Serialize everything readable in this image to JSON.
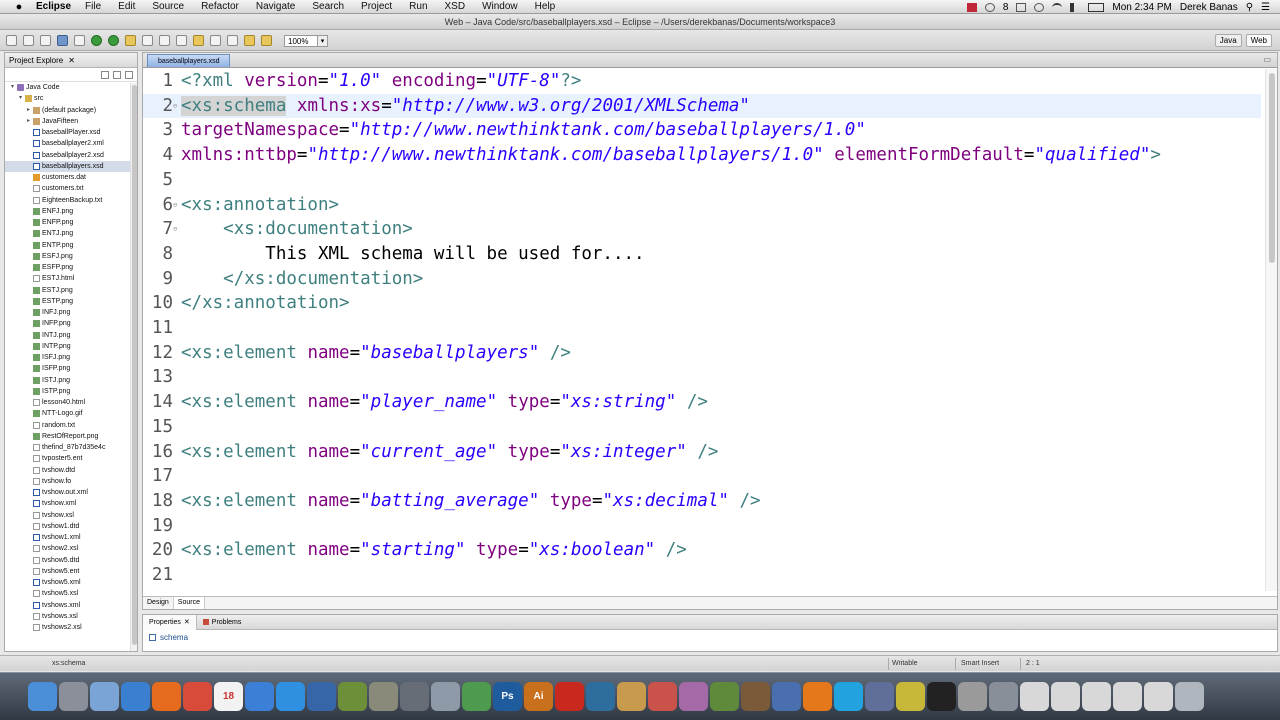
{
  "menubar": {
    "app_name": "Eclipse",
    "items": [
      "File",
      "Edit",
      "Source",
      "Refactor",
      "Navigate",
      "Search",
      "Project",
      "Run",
      "XSD",
      "Window",
      "Help"
    ],
    "status_number": "8",
    "clock": "Mon 2:34 PM",
    "user": "Derek Banas"
  },
  "window": {
    "title": "Web – Java Code/src/baseballplayers.xsd – Eclipse – /Users/derekbanas/Documents/workspace3"
  },
  "toolbar": {
    "zoom": "100%",
    "perspectives": [
      "Java",
      "Web"
    ]
  },
  "project_explorer": {
    "title": "Project Explore",
    "items": [
      {
        "label": "Java Code",
        "icon": "project-icon",
        "kind": "project",
        "indent": 0,
        "twisty": "▾"
      },
      {
        "label": "src",
        "icon": "folder-icon",
        "kind": "folder",
        "indent": 1,
        "twisty": "▾"
      },
      {
        "label": "(default package)",
        "icon": "package-icon",
        "kind": "pkg",
        "indent": 2,
        "twisty": "▸"
      },
      {
        "label": "JavaFifteen",
        "icon": "package-icon",
        "kind": "pkg",
        "indent": 2,
        "twisty": "▸"
      },
      {
        "label": "baseballPlayer.xsd",
        "icon": "xml-file-icon",
        "kind": "xml",
        "indent": 2,
        "twisty": ""
      },
      {
        "label": "baseballplayer2.xml",
        "icon": "xml-file-icon",
        "kind": "xml",
        "indent": 2,
        "twisty": ""
      },
      {
        "label": "baseballplayer2.xsd",
        "icon": "xml-file-icon",
        "kind": "xml",
        "indent": 2,
        "twisty": ""
      },
      {
        "label": "baseballplayers.xsd",
        "icon": "xml-file-icon",
        "kind": "xml",
        "indent": 2,
        "twisty": "",
        "selected": true
      },
      {
        "label": "customers.dat",
        "icon": "data-file-icon",
        "kind": "dat",
        "indent": 2,
        "twisty": ""
      },
      {
        "label": "customers.txt",
        "icon": "text-file-icon",
        "kind": "txt",
        "indent": 2,
        "twisty": ""
      },
      {
        "label": "EighteenBackup.txt",
        "icon": "text-file-icon",
        "kind": "txt",
        "indent": 2,
        "twisty": ""
      },
      {
        "label": "ENFJ.png",
        "icon": "image-file-icon",
        "kind": "png",
        "indent": 2,
        "twisty": ""
      },
      {
        "label": "ENFP.png",
        "icon": "image-file-icon",
        "kind": "png",
        "indent": 2,
        "twisty": ""
      },
      {
        "label": "ENTJ.png",
        "icon": "image-file-icon",
        "kind": "png",
        "indent": 2,
        "twisty": ""
      },
      {
        "label": "ENTP.png",
        "icon": "image-file-icon",
        "kind": "png",
        "indent": 2,
        "twisty": ""
      },
      {
        "label": "ESFJ.png",
        "icon": "image-file-icon",
        "kind": "png",
        "indent": 2,
        "twisty": ""
      },
      {
        "label": "ESFP.png",
        "icon": "image-file-icon",
        "kind": "png",
        "indent": 2,
        "twisty": ""
      },
      {
        "label": "ESTJ.html",
        "icon": "text-file-icon",
        "kind": "txt",
        "indent": 2,
        "twisty": ""
      },
      {
        "label": "ESTJ.png",
        "icon": "image-file-icon",
        "kind": "png",
        "indent": 2,
        "twisty": ""
      },
      {
        "label": "ESTP.png",
        "icon": "image-file-icon",
        "kind": "png",
        "indent": 2,
        "twisty": ""
      },
      {
        "label": "INFJ.png",
        "icon": "image-file-icon",
        "kind": "png",
        "indent": 2,
        "twisty": ""
      },
      {
        "label": "INFP.png",
        "icon": "image-file-icon",
        "kind": "png",
        "indent": 2,
        "twisty": ""
      },
      {
        "label": "INTJ.png",
        "icon": "image-file-icon",
        "kind": "png",
        "indent": 2,
        "twisty": ""
      },
      {
        "label": "INTP.png",
        "icon": "image-file-icon",
        "kind": "png",
        "indent": 2,
        "twisty": ""
      },
      {
        "label": "ISFJ.png",
        "icon": "image-file-icon",
        "kind": "png",
        "indent": 2,
        "twisty": ""
      },
      {
        "label": "ISFP.png",
        "icon": "image-file-icon",
        "kind": "png",
        "indent": 2,
        "twisty": ""
      },
      {
        "label": "ISTJ.png",
        "icon": "image-file-icon",
        "kind": "png",
        "indent": 2,
        "twisty": ""
      },
      {
        "label": "ISTP.png",
        "icon": "image-file-icon",
        "kind": "png",
        "indent": 2,
        "twisty": ""
      },
      {
        "label": "lesson40.html",
        "icon": "text-file-icon",
        "kind": "txt",
        "indent": 2,
        "twisty": ""
      },
      {
        "label": "NTT-Logo.gif",
        "icon": "image-file-icon",
        "kind": "png",
        "indent": 2,
        "twisty": ""
      },
      {
        "label": "random.txt",
        "icon": "text-file-icon",
        "kind": "txt",
        "indent": 2,
        "twisty": ""
      },
      {
        "label": "RestOfReport.png",
        "icon": "image-file-icon",
        "kind": "png",
        "indent": 2,
        "twisty": ""
      },
      {
        "label": "thefind_87b7d35e4c",
        "icon": "text-file-icon",
        "kind": "txt",
        "indent": 2,
        "twisty": ""
      },
      {
        "label": "tvposter5.ent",
        "icon": "text-file-icon",
        "kind": "txt",
        "indent": 2,
        "twisty": ""
      },
      {
        "label": "tvshow.dtd",
        "icon": "text-file-icon",
        "kind": "txt",
        "indent": 2,
        "twisty": ""
      },
      {
        "label": "tvshow.fo",
        "icon": "text-file-icon",
        "kind": "txt",
        "indent": 2,
        "twisty": ""
      },
      {
        "label": "tvshow.out.xml",
        "icon": "xml-file-icon",
        "kind": "xml",
        "indent": 2,
        "twisty": ""
      },
      {
        "label": "tvshow.xml",
        "icon": "xml-file-icon",
        "kind": "xml",
        "indent": 2,
        "twisty": ""
      },
      {
        "label": "tvshow.xsl",
        "icon": "text-file-icon",
        "kind": "txt",
        "indent": 2,
        "twisty": ""
      },
      {
        "label": "tvshow1.dtd",
        "icon": "text-file-icon",
        "kind": "txt",
        "indent": 2,
        "twisty": ""
      },
      {
        "label": "tvshow1.xml",
        "icon": "xml-file-icon",
        "kind": "xml",
        "indent": 2,
        "twisty": ""
      },
      {
        "label": "tvshow2.xsl",
        "icon": "text-file-icon",
        "kind": "txt",
        "indent": 2,
        "twisty": ""
      },
      {
        "label": "tvshow5.dtd",
        "icon": "text-file-icon",
        "kind": "txt",
        "indent": 2,
        "twisty": ""
      },
      {
        "label": "tvshow5.ent",
        "icon": "text-file-icon",
        "kind": "txt",
        "indent": 2,
        "twisty": ""
      },
      {
        "label": "tvshow5.xml",
        "icon": "xml-file-icon",
        "kind": "xml",
        "indent": 2,
        "twisty": ""
      },
      {
        "label": "tvshow5.xsl",
        "icon": "text-file-icon",
        "kind": "txt",
        "indent": 2,
        "twisty": ""
      },
      {
        "label": "tvshows.xml",
        "icon": "xml-file-icon",
        "kind": "xml",
        "indent": 2,
        "twisty": ""
      },
      {
        "label": "tvshows.xsl",
        "icon": "text-file-icon",
        "kind": "txt",
        "indent": 2,
        "twisty": ""
      },
      {
        "label": "tvshows2.xsl",
        "icon": "text-file-icon",
        "kind": "txt",
        "indent": 2,
        "twisty": ""
      }
    ]
  },
  "editor": {
    "tab_label": "baseballplayers.xsd",
    "current_line": 2,
    "lines": [
      {
        "n": "1",
        "fold": "",
        "parts": [
          [
            "tag",
            "<?xml "
          ],
          [
            "attr",
            "version"
          ],
          [
            "txt",
            "="
          ],
          [
            "val",
            "\"1.0\""
          ],
          [
            "txt",
            " "
          ],
          [
            "attr",
            "encoding"
          ],
          [
            "txt",
            "="
          ],
          [
            "val",
            "\"UTF-8\""
          ],
          [
            "tag",
            "?>"
          ]
        ]
      },
      {
        "n": "2",
        "fold": "⊖",
        "parts": [
          [
            "sel",
            "<xs:schema"
          ],
          [
            "txt",
            " "
          ],
          [
            "attr",
            "xmlns:xs"
          ],
          [
            "txt",
            "="
          ],
          [
            "val",
            "\"http://www.w3.org/2001/XMLSchema\""
          ]
        ]
      },
      {
        "n": "3",
        "fold": "",
        "parts": [
          [
            "attr",
            "targetNamespace"
          ],
          [
            "txt",
            "="
          ],
          [
            "val",
            "\"http://www.newthinktank.com/baseballplayers/1.0\""
          ]
        ]
      },
      {
        "n": "4",
        "fold": "",
        "parts": [
          [
            "attr",
            "xmlns:nttbp"
          ],
          [
            "txt",
            "="
          ],
          [
            "val",
            "\"http://www.newthinktank.com/baseballplayers/1.0\""
          ],
          [
            "txt",
            " "
          ],
          [
            "attr",
            "elementFormDefault"
          ],
          [
            "txt",
            "="
          ],
          [
            "val",
            "\"qualified\""
          ],
          [
            "tag",
            ">"
          ]
        ]
      },
      {
        "n": "5",
        "fold": "",
        "parts": []
      },
      {
        "n": "6",
        "fold": "⊖",
        "parts": [
          [
            "tag",
            "<xs:annotation>"
          ]
        ]
      },
      {
        "n": "7",
        "fold": "⊖",
        "parts": [
          [
            "txt",
            "    "
          ],
          [
            "tag",
            "<xs:documentation>"
          ]
        ]
      },
      {
        "n": "8",
        "fold": "",
        "parts": [
          [
            "txt",
            "        This XML schema will be used for...."
          ]
        ]
      },
      {
        "n": "9",
        "fold": "",
        "parts": [
          [
            "txt",
            "    "
          ],
          [
            "tag",
            "</xs:documentation>"
          ]
        ]
      },
      {
        "n": "10",
        "fold": "",
        "parts": [
          [
            "tag",
            "</xs:annotation>"
          ]
        ]
      },
      {
        "n": "11",
        "fold": "",
        "parts": []
      },
      {
        "n": "12",
        "fold": "",
        "parts": [
          [
            "tag",
            "<xs:element "
          ],
          [
            "attr",
            "name"
          ],
          [
            "txt",
            "="
          ],
          [
            "val",
            "\"baseballplayers\""
          ],
          [
            "txt",
            " "
          ],
          [
            "tag",
            "/>"
          ]
        ]
      },
      {
        "n": "13",
        "fold": "",
        "parts": []
      },
      {
        "n": "14",
        "fold": "",
        "parts": [
          [
            "tag",
            "<xs:element "
          ],
          [
            "attr",
            "name"
          ],
          [
            "txt",
            "="
          ],
          [
            "val",
            "\"player_name\""
          ],
          [
            "txt",
            " "
          ],
          [
            "attr",
            "type"
          ],
          [
            "txt",
            "="
          ],
          [
            "val",
            "\"xs:string\""
          ],
          [
            "txt",
            " "
          ],
          [
            "tag",
            "/>"
          ]
        ]
      },
      {
        "n": "15",
        "fold": "",
        "parts": []
      },
      {
        "n": "16",
        "fold": "",
        "parts": [
          [
            "tag",
            "<xs:element "
          ],
          [
            "attr",
            "name"
          ],
          [
            "txt",
            "="
          ],
          [
            "val",
            "\"current_age\""
          ],
          [
            "txt",
            " "
          ],
          [
            "attr",
            "type"
          ],
          [
            "txt",
            "="
          ],
          [
            "val",
            "\"xs:integer\""
          ],
          [
            "txt",
            " "
          ],
          [
            "tag",
            "/>"
          ]
        ]
      },
      {
        "n": "17",
        "fold": "",
        "parts": []
      },
      {
        "n": "18",
        "fold": "",
        "parts": [
          [
            "tag",
            "<xs:element "
          ],
          [
            "attr",
            "name"
          ],
          [
            "txt",
            "="
          ],
          [
            "val",
            "\"batting_average\""
          ],
          [
            "txt",
            " "
          ],
          [
            "attr",
            "type"
          ],
          [
            "txt",
            "="
          ],
          [
            "val",
            "\"xs:decimal\""
          ],
          [
            "txt",
            " "
          ],
          [
            "tag",
            "/>"
          ]
        ]
      },
      {
        "n": "19",
        "fold": "",
        "parts": []
      },
      {
        "n": "20",
        "fold": "",
        "parts": [
          [
            "tag",
            "<xs:element "
          ],
          [
            "attr",
            "name"
          ],
          [
            "txt",
            "="
          ],
          [
            "val",
            "\"starting\""
          ],
          [
            "txt",
            " "
          ],
          [
            "attr",
            "type"
          ],
          [
            "txt",
            "="
          ],
          [
            "val",
            "\"xs:boolean\""
          ],
          [
            "txt",
            " "
          ],
          [
            "tag",
            "/>"
          ]
        ]
      },
      {
        "n": "21",
        "fold": "",
        "parts": []
      }
    ],
    "bottom_tabs": [
      "Design",
      "Source"
    ]
  },
  "properties": {
    "tabs": [
      "Properties",
      "Problems"
    ],
    "content": "schema"
  },
  "statusbar": {
    "path": "xs:schema",
    "writable": "Writable",
    "insert_mode": "Smart Insert",
    "position": "2 : 1"
  },
  "dock": {
    "apps": [
      {
        "icon": "finder-icon",
        "color": "#4a8fd8",
        "label": ""
      },
      {
        "icon": "launchpad-icon",
        "color": "#8a8f99",
        "label": ""
      },
      {
        "icon": "preview-icon",
        "color": "#7aa4d6",
        "label": ""
      },
      {
        "icon": "safari-icon",
        "color": "#3a7fd0",
        "label": ""
      },
      {
        "icon": "firefox-icon",
        "color": "#e66b1e",
        "label": ""
      },
      {
        "icon": "chrome-icon",
        "color": "#d84a3a",
        "label": ""
      },
      {
        "icon": "calendar-icon",
        "color": "#f2f2f2",
        "label": "18"
      },
      {
        "icon": "itunes-icon",
        "color": "#3c7fd6",
        "label": ""
      },
      {
        "icon": "appstore-icon",
        "color": "#2f8fe0",
        "label": ""
      },
      {
        "icon": "quicktime-icon",
        "color": "#3666a8",
        "label": ""
      },
      {
        "icon": "xcode-icon",
        "color": "#6d8f3a",
        "label": ""
      },
      {
        "icon": "tools-icon",
        "color": "#8a8a7a",
        "label": ""
      },
      {
        "icon": "utility-icon",
        "color": "#666d77",
        "label": ""
      },
      {
        "icon": "pen-icon",
        "color": "#8f9aa8",
        "label": ""
      },
      {
        "icon": "numbers-icon",
        "color": "#4e9a4e",
        "label": ""
      },
      {
        "icon": "photoshop-icon",
        "color": "#1f5c9e",
        "label": "Ps"
      },
      {
        "icon": "illustrator-icon",
        "color": "#c9701c",
        "label": "Ai"
      },
      {
        "icon": "acrobat-icon",
        "color": "#c8281e",
        "label": ""
      },
      {
        "icon": "dreamweaver-icon",
        "color": "#2e6e9e",
        "label": ""
      },
      {
        "icon": "palette-icon",
        "color": "#c79a4e",
        "label": ""
      },
      {
        "icon": "css-icon",
        "color": "#c9534a",
        "label": ""
      },
      {
        "icon": "monster-icon",
        "color": "#a569a8",
        "label": ""
      },
      {
        "icon": "minecraft-icon",
        "color": "#5f8a3c",
        "label": ""
      },
      {
        "icon": "books-icon",
        "color": "#7b5a3a",
        "label": ""
      },
      {
        "icon": "clapper-icon",
        "color": "#4a6fae",
        "label": ""
      },
      {
        "icon": "vlc-icon",
        "color": "#e6781c",
        "label": ""
      },
      {
        "icon": "skype-icon",
        "color": "#22a3e0",
        "label": ""
      },
      {
        "icon": "globe-icon",
        "color": "#5f6f9a",
        "label": ""
      },
      {
        "icon": "sublime-icon",
        "color": "#c8b83a",
        "label": ""
      },
      {
        "icon": "terminal-icon",
        "color": "#222222",
        "label": ""
      },
      {
        "icon": "calculator-icon",
        "color": "#9a9a9a",
        "label": ""
      },
      {
        "icon": "image-icon",
        "color": "#888f99",
        "label": ""
      },
      {
        "icon": "document-icon",
        "color": "#d8d8d8",
        "label": ""
      },
      {
        "icon": "document-icon",
        "color": "#d8d8d8",
        "label": ""
      },
      {
        "icon": "document-icon",
        "color": "#d8d8d8",
        "label": ""
      },
      {
        "icon": "document-icon",
        "color": "#d8d8d8",
        "label": ""
      },
      {
        "icon": "document-icon",
        "color": "#d8d8d8",
        "label": ""
      },
      {
        "icon": "trash-icon",
        "color": "#b0b6be",
        "label": ""
      }
    ]
  }
}
